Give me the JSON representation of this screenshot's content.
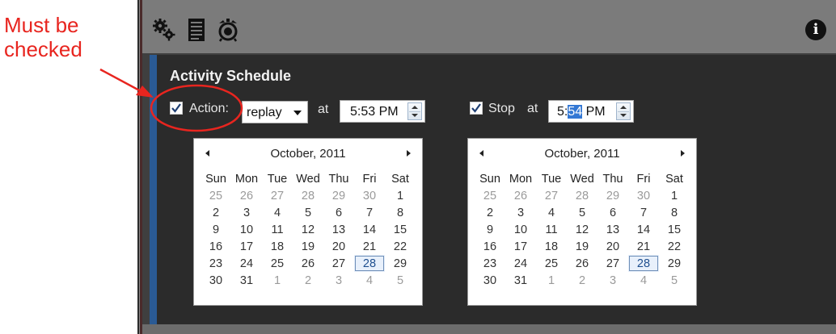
{
  "annotation": {
    "line1": "Must be",
    "line2": "checked",
    "color": "#e8251f"
  },
  "toolbar": {
    "icons": [
      "gears-icon",
      "document-icon",
      "alarm-clock-icon"
    ],
    "info_icon": "info-icon"
  },
  "schedule": {
    "title": "Activity Schedule",
    "action": {
      "checked": true,
      "label": "Action:",
      "select_value": "replay",
      "at_label": "at",
      "time": "5:53 PM"
    },
    "stop": {
      "checked": true,
      "label": "Stop",
      "at_label": "at",
      "time_prefix": "5:",
      "time_selected": "54",
      "time_suffix": " PM"
    }
  },
  "calendars": [
    {
      "month": "October, 2011",
      "weekdays": [
        "Sun",
        "Mon",
        "Tue",
        "Wed",
        "Thu",
        "Fri",
        "Sat"
      ],
      "weeks": [
        [
          "25",
          "26",
          "27",
          "28",
          "29",
          "30",
          "1"
        ],
        [
          "2",
          "3",
          "4",
          "5",
          "6",
          "7",
          "8"
        ],
        [
          "9",
          "10",
          "11",
          "12",
          "13",
          "14",
          "15"
        ],
        [
          "16",
          "17",
          "18",
          "19",
          "20",
          "21",
          "22"
        ],
        [
          "23",
          "24",
          "25",
          "26",
          "27",
          "28",
          "29"
        ],
        [
          "30",
          "31",
          "1",
          "2",
          "3",
          "4",
          "5"
        ]
      ],
      "selected": "28"
    },
    {
      "month": "October, 2011",
      "weekdays": [
        "Sun",
        "Mon",
        "Tue",
        "Wed",
        "Thu",
        "Fri",
        "Sat"
      ],
      "weeks": [
        [
          "25",
          "26",
          "27",
          "28",
          "29",
          "30",
          "1"
        ],
        [
          "2",
          "3",
          "4",
          "5",
          "6",
          "7",
          "8"
        ],
        [
          "9",
          "10",
          "11",
          "12",
          "13",
          "14",
          "15"
        ],
        [
          "16",
          "17",
          "18",
          "19",
          "20",
          "21",
          "22"
        ],
        [
          "23",
          "24",
          "25",
          "26",
          "27",
          "28",
          "29"
        ],
        [
          "30",
          "31",
          "1",
          "2",
          "3",
          "4",
          "5"
        ]
      ],
      "selected": "28"
    }
  ]
}
